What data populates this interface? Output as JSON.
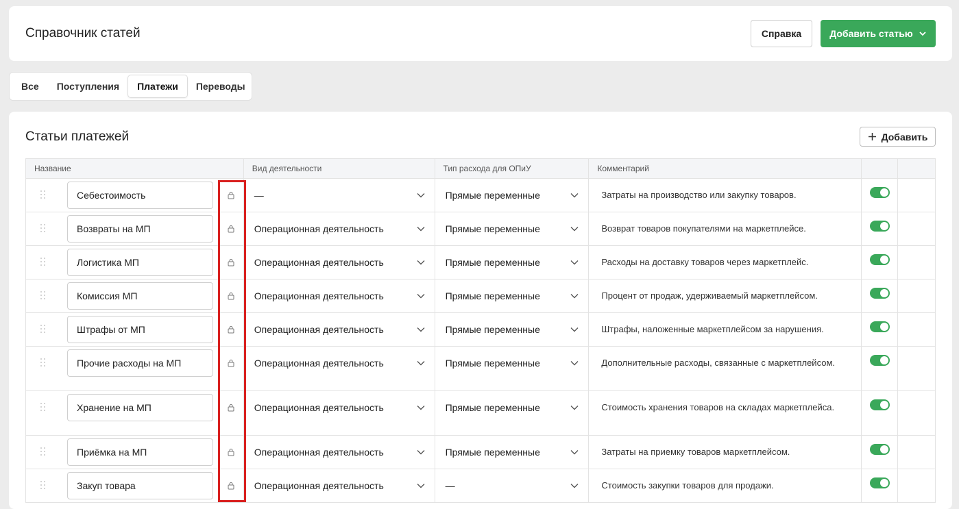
{
  "header": {
    "title": "Справочник статей",
    "help_label": "Справка",
    "add_article_label": "Добавить статью"
  },
  "tabs": [
    {
      "label": "Все",
      "active": false
    },
    {
      "label": "Поступления",
      "active": false
    },
    {
      "label": "Платежи",
      "active": true
    },
    {
      "label": "Переводы",
      "active": false
    }
  ],
  "section": {
    "title": "Статьи платежей",
    "add_label": "Добавить"
  },
  "table": {
    "columns": [
      "Название",
      "Вид деятельности",
      "Тип расхода для ОПиУ",
      "Комментарий"
    ],
    "rows": [
      {
        "name": "Себестоимость",
        "activity": "—",
        "expense_type": "Прямые переменные",
        "comment": "Затраты на производство или закупку товаров.",
        "enabled": true
      },
      {
        "name": "Возвраты на МП",
        "activity": "Операционная деятельность",
        "expense_type": "Прямые переменные",
        "comment": "Возврат товаров покупателями на маркетплейсе.",
        "enabled": true
      },
      {
        "name": "Логистика МП",
        "activity": "Операционная деятельность",
        "expense_type": "Прямые переменные",
        "comment": "Расходы на доставку товаров через маркетплейс.",
        "enabled": true
      },
      {
        "name": "Комиссия МП",
        "activity": "Операционная деятельность",
        "expense_type": "Прямые переменные",
        "comment": "Процент от продаж, удерживаемый маркетплейсом.",
        "enabled": true
      },
      {
        "name": "Штрафы от МП",
        "activity": "Операционная деятельность",
        "expense_type": "Прямые переменные",
        "comment": "Штрафы, наложенные маркетплейсом за нарушения.",
        "enabled": true
      },
      {
        "name": "Прочие расходы на МП",
        "activity": "Операционная деятельность",
        "expense_type": "Прямые переменные",
        "comment": "Дополнительные расходы, связанные с маркетплейсом.",
        "enabled": true
      },
      {
        "name": "Хранение на МП",
        "activity": "Операционная деятельность",
        "expense_type": "Прямые переменные",
        "comment": "Стоимость хранения товаров на складах маркетплейса.",
        "enabled": true
      },
      {
        "name": "Приёмка на МП",
        "activity": "Операционная деятельность",
        "expense_type": "Прямые переменные",
        "comment": "Затраты на приемку товаров маркетплейсом.",
        "enabled": true
      },
      {
        "name": "Закуп товара",
        "activity": "Операционная деятельность",
        "expense_type": "—",
        "comment": "Стоимость закупки товаров для продажи.",
        "enabled": true
      }
    ]
  },
  "colors": {
    "accent_green": "#3aa85a",
    "highlight_red": "#d9201f"
  }
}
